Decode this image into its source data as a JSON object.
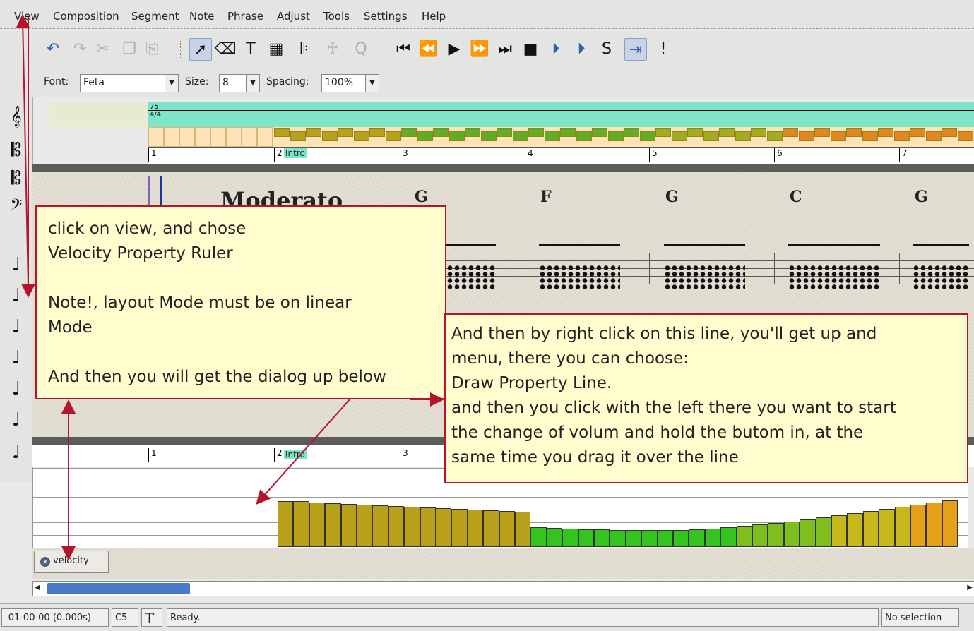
{
  "menu": {
    "items": [
      "View",
      "Composition",
      "Segment",
      "Note",
      "Phrase",
      "Adjust",
      "Tools",
      "Settings",
      "Help"
    ]
  },
  "toolbar": {
    "buttons": [
      {
        "name": "undo-icon",
        "glyph": "↶"
      },
      {
        "name": "redo-icon",
        "glyph": "↷"
      },
      {
        "name": "cut-icon",
        "glyph": "✂"
      },
      {
        "name": "copy-icon",
        "glyph": "❐"
      },
      {
        "name": "paste-icon",
        "glyph": "⎘"
      },
      {
        "name": "select-tool-icon",
        "glyph": "➚"
      },
      {
        "name": "eraser-tool-icon",
        "glyph": "⌫"
      },
      {
        "name": "text-tool-icon",
        "glyph": "T"
      },
      {
        "name": "guitar-chord-tool-icon",
        "glyph": "▦"
      },
      {
        "name": "symbol-tool-icon",
        "glyph": "𝄆"
      },
      {
        "name": "fingering-tool-icon",
        "glyph": "♰"
      },
      {
        "name": "quantize-icon",
        "glyph": "Q"
      },
      {
        "name": "rewind-to-start-icon",
        "glyph": "⏮"
      },
      {
        "name": "rewind-icon",
        "glyph": "⏪"
      },
      {
        "name": "play-icon",
        "glyph": "▶"
      },
      {
        "name": "fast-forward-icon",
        "glyph": "⏩"
      },
      {
        "name": "fast-forward-to-end-icon",
        "glyph": "⏭"
      },
      {
        "name": "stop-icon",
        "glyph": "■"
      },
      {
        "name": "loop-start-icon",
        "glyph": "⏵"
      },
      {
        "name": "loop-end-icon",
        "glyph": "⏵"
      },
      {
        "name": "solo-icon",
        "glyph": "S"
      },
      {
        "name": "follow-playback-icon",
        "glyph": "⇥"
      },
      {
        "name": "panic-icon",
        "glyph": "!"
      }
    ]
  },
  "fontrow": {
    "font_label": "Font:",
    "font_value": "Feta",
    "size_label": "Size:",
    "size_value": "8",
    "spacing_label": "Spacing:",
    "spacing_value": "100%"
  },
  "palette": [
    {
      "name": "treble-clef-icon",
      "glyph": "𝄞"
    },
    {
      "name": "alto-clef-icon",
      "glyph": "𝄡"
    },
    {
      "name": "tenor-clef-icon",
      "glyph": "𝄡"
    },
    {
      "name": "bass-clef-icon",
      "glyph": "𝄢"
    },
    {
      "name": "quarter-note-icon",
      "glyph": "♩"
    },
    {
      "name": "natural-note-icon",
      "glyph": "♩"
    },
    {
      "name": "sharp-note-icon",
      "glyph": "♩"
    },
    {
      "name": "flat-note-icon",
      "glyph": "♩"
    },
    {
      "name": "natural-note-2-icon",
      "glyph": "♩"
    },
    {
      "name": "double-sharp-note-icon",
      "glyph": "♩"
    },
    {
      "name": "double-flat-note-icon",
      "glyph": "♩"
    }
  ],
  "ruler": {
    "tempo_text": "75",
    "time_sig": "4/4",
    "bars": [
      "1",
      "2",
      "3",
      "4",
      "5",
      "6",
      "7"
    ],
    "marker": "Intro",
    "lower_bars": [
      "1",
      "2",
      "3"
    ],
    "lower_marker": "Intro"
  },
  "score": {
    "tempo_marking": "Moderato",
    "chords": [
      "G",
      "F",
      "G",
      "C",
      "G"
    ]
  },
  "velocity_tab": {
    "label": "velocity"
  },
  "status": {
    "time": "-01-00-00 (0.000s)",
    "pitch": "C5",
    "t_icon": "T",
    "message": "Ready.",
    "selection": "No selection"
  },
  "callouts": {
    "view_help": [
      "click on view, and chose",
      "Velocity Property Ruler",
      "",
      "Note!, layout Mode must be on linear",
      "Mode",
      "",
      "And then you will get the dialog up below"
    ],
    "line_help": [
      "And then by right click on this line, you'll get up and",
      "menu, there you can choose:",
      "Draw Property Line.",
      "and then you click with the left there you want to start",
      "the change of volum and hold the butom in, at the",
      "same time you drag it over the line"
    ]
  },
  "velocity_values": [
    65,
    65,
    63,
    62,
    61,
    60,
    59,
    58,
    57,
    56,
    55,
    54,
    53,
    52,
    51,
    50,
    28,
    27,
    26,
    25,
    25,
    24,
    24,
    24,
    24,
    24,
    25,
    26,
    28,
    30,
    32,
    34,
    36,
    39,
    42,
    45,
    48,
    51,
    54,
    57,
    60,
    63,
    66,
    70,
    74,
    78,
    82,
    84
  ],
  "colors": {
    "accent_red": "#b5152c",
    "callout_bg": "#fffccd",
    "marker_teal": "#7fe5c9"
  }
}
